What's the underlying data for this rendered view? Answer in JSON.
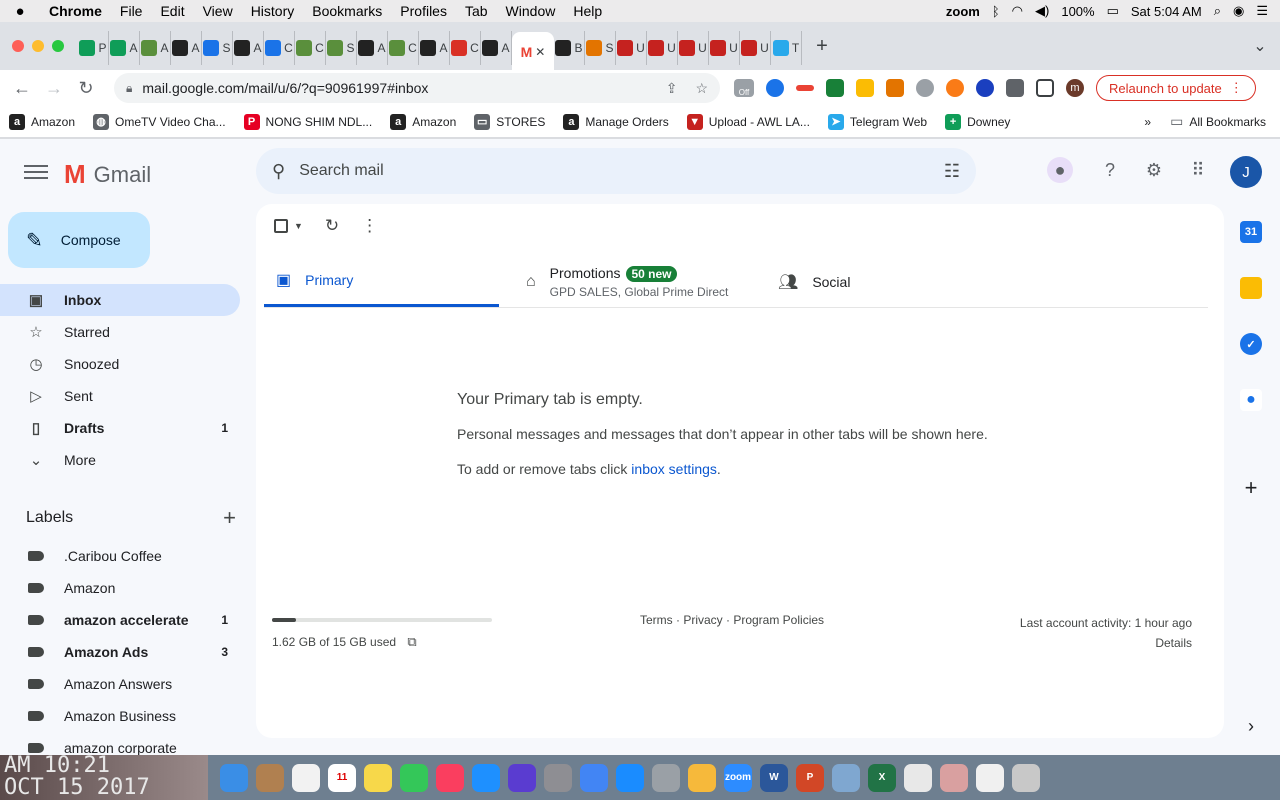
{
  "menubar": {
    "app": "Chrome",
    "items": [
      "File",
      "Edit",
      "View",
      "History",
      "Bookmarks",
      "Profiles",
      "Tab",
      "Window",
      "Help"
    ],
    "zoom": "zoom",
    "battery": "100%",
    "clock": "Sat 5:04 AM"
  },
  "tabs": [
    {
      "letter": "P",
      "icon": "sheets-icon",
      "color": "#0f9d58"
    },
    {
      "letter": "A",
      "icon": "sheets-icon",
      "color": "#0f9d58"
    },
    {
      "letter": "A",
      "icon": "plant-icon",
      "color": "#5a8f3c"
    },
    {
      "letter": "A",
      "icon": "amazon-icon",
      "color": "#222"
    },
    {
      "letter": "S",
      "icon": "diamond-icon",
      "color": "#1a73e8"
    },
    {
      "letter": "A",
      "icon": "amazon-icon",
      "color": "#222"
    },
    {
      "letter": "C",
      "icon": "diamond-icon",
      "color": "#1a73e8"
    },
    {
      "letter": "C",
      "icon": "plant-icon",
      "color": "#5a8f3c"
    },
    {
      "letter": "S",
      "icon": "plant-icon",
      "color": "#5a8f3c"
    },
    {
      "letter": "A",
      "icon": "amazon-icon",
      "color": "#222"
    },
    {
      "letter": "C",
      "icon": "plant-icon",
      "color": "#5a8f3c"
    },
    {
      "letter": "A",
      "icon": "amazon-icon",
      "color": "#222"
    },
    {
      "letter": "C",
      "icon": "c-icon",
      "color": "#d93025"
    },
    {
      "letter": "A",
      "icon": "amazon-icon",
      "color": "#222"
    }
  ],
  "tabs2": [
    {
      "letter": "B",
      "icon": "amazon-icon",
      "color": "#222"
    },
    {
      "letter": "S",
      "icon": "target-icon",
      "color": "#e37400"
    },
    {
      "letter": "U",
      "icon": "flag-icon",
      "color": "#c5221f"
    },
    {
      "letter": "U",
      "icon": "flag-icon",
      "color": "#c5221f"
    },
    {
      "letter": "U",
      "icon": "flag-icon",
      "color": "#c5221f"
    },
    {
      "letter": "U",
      "icon": "flag-icon",
      "color": "#c5221f"
    },
    {
      "letter": "U",
      "icon": "flag-icon",
      "color": "#c5221f"
    },
    {
      "letter": "T",
      "icon": "telegram-icon",
      "color": "#29a9eb"
    }
  ],
  "toolbar": {
    "url": "mail.google.com/mail/u/6/?q=90961997#inbox",
    "relaunch": "Relaunch to update",
    "profile_initial": "m",
    "ext_badge": "Off"
  },
  "bookmarks": [
    {
      "label": "Amazon",
      "icon": "amazon-icon",
      "color": "#222",
      "glyph": "a"
    },
    {
      "label": "OmeTV Video Cha...",
      "icon": "globe-icon",
      "color": "#5f6368",
      "glyph": "◍"
    },
    {
      "label": "NONG SHIM NDL...",
      "icon": "pinterest-icon",
      "color": "#e60023",
      "glyph": "P"
    },
    {
      "label": "Amazon",
      "icon": "amazon-icon",
      "color": "#222",
      "glyph": "a"
    },
    {
      "label": "STORES",
      "icon": "folder-icon",
      "color": "#5f6368",
      "glyph": "▭"
    },
    {
      "label": "Manage Orders",
      "icon": "amazon-icon",
      "color": "#222",
      "glyph": "a"
    },
    {
      "label": "Upload - AWL LA...",
      "icon": "flag-icon",
      "color": "#c5221f",
      "glyph": "▼"
    },
    {
      "label": "Telegram Web",
      "icon": "telegram-icon",
      "color": "#29a9eb",
      "glyph": "➤"
    },
    {
      "label": "Downey",
      "icon": "sheets-icon",
      "color": "#0f9d58",
      "glyph": "+"
    }
  ],
  "bookmarks_all": "All Bookmarks",
  "gmail": {
    "brand": "Gmail",
    "search_placeholder": "Search mail",
    "avatar": "J",
    "compose": "Compose",
    "nav": [
      {
        "label": "Inbox",
        "icon": "inbox-icon",
        "glyph": "▣",
        "count": "",
        "active": true,
        "bold": true
      },
      {
        "label": "Starred",
        "icon": "star-icon",
        "glyph": "☆",
        "count": "",
        "active": false,
        "bold": false
      },
      {
        "label": "Snoozed",
        "icon": "clock-icon",
        "glyph": "◷",
        "count": "",
        "active": false,
        "bold": false
      },
      {
        "label": "Sent",
        "icon": "send-icon",
        "glyph": "▷",
        "count": "",
        "active": false,
        "bold": false
      },
      {
        "label": "Drafts",
        "icon": "draft-icon",
        "glyph": "▯",
        "count": "1",
        "active": false,
        "bold": true
      },
      {
        "label": "More",
        "icon": "chevron-down-icon",
        "glyph": "⌄",
        "count": "",
        "active": false,
        "bold": false
      }
    ],
    "labels_title": "Labels",
    "labels": [
      {
        "label": ".Caribou Coffee",
        "count": "",
        "bold": false
      },
      {
        "label": "Amazon",
        "count": "",
        "bold": false
      },
      {
        "label": "amazon accelerate",
        "count": "1",
        "bold": true
      },
      {
        "label": "Amazon Ads",
        "count": "3",
        "bold": true
      },
      {
        "label": "Amazon Answers",
        "count": "",
        "bold": false
      },
      {
        "label": "Amazon Business",
        "count": "",
        "bold": false
      },
      {
        "label": "amazon corporate",
        "count": "",
        "bold": false
      }
    ],
    "category_tabs": {
      "primary": "Primary",
      "promotions": "Promotions",
      "promotions_badge": "50 new",
      "promotions_sub": "GPD SALES, Global Prime Direct",
      "social": "Social"
    },
    "empty": {
      "heading": "Your Primary tab is empty.",
      "body": "Personal messages and messages that don’t appear in other tabs will be shown here.",
      "settings_prefix": "To add or remove tabs click ",
      "settings_link": "inbox settings",
      "settings_suffix": "."
    },
    "storage": {
      "text": "1.62 GB of 15 GB used",
      "fraction": 0.108
    },
    "footer_links": "Terms · Privacy · Program Policies",
    "last_activity": "Last account activity: 1 hour ago",
    "details": "Details"
  },
  "desktop_text": [
    "AM 10:21",
    "OCT 15 2017"
  ],
  "dock": [
    {
      "icon": "finder-icon",
      "color": "#3a8ee6"
    },
    {
      "icon": "contacts-icon",
      "color": "#b08050"
    },
    {
      "icon": "reminders-icon",
      "color": "#f2f2f2"
    },
    {
      "icon": "calendar-icon",
      "color": "#ffffff",
      "text": "11"
    },
    {
      "icon": "notes-icon",
      "color": "#f7d84a"
    },
    {
      "icon": "facetime-icon",
      "color": "#34c759"
    },
    {
      "icon": "music-icon",
      "color": "#fa3e5f"
    },
    {
      "icon": "appstore-icon",
      "color": "#1e90ff"
    },
    {
      "icon": "siri-icon",
      "color": "#5a3cd0"
    },
    {
      "icon": "settings-icon",
      "color": "#8e8e93"
    },
    {
      "icon": "chrome-icon",
      "color": "#4285f4"
    },
    {
      "icon": "safari-icon",
      "color": "#1a8cff"
    },
    {
      "icon": "launchpad-icon",
      "color": "#9aa0a6"
    },
    {
      "icon": "photos-icon",
      "color": "#f6b93b"
    },
    {
      "icon": "zoom-icon",
      "color": "#2d8cff",
      "text": "zoom"
    },
    {
      "icon": "word-icon",
      "color": "#2b579a",
      "text": "W"
    },
    {
      "icon": "powerpoint-icon",
      "color": "#d24726",
      "text": "P"
    },
    {
      "icon": "preview-icon",
      "color": "#7fa7d0"
    },
    {
      "icon": "excel-icon",
      "color": "#217346",
      "text": "X"
    },
    {
      "icon": "document-icon",
      "color": "#e8e8e8"
    },
    {
      "icon": "photo-icon",
      "color": "#d9a0a0"
    },
    {
      "icon": "document-icon",
      "color": "#f0f0f0"
    },
    {
      "icon": "trash-icon",
      "color": "#c8c8c8"
    }
  ]
}
